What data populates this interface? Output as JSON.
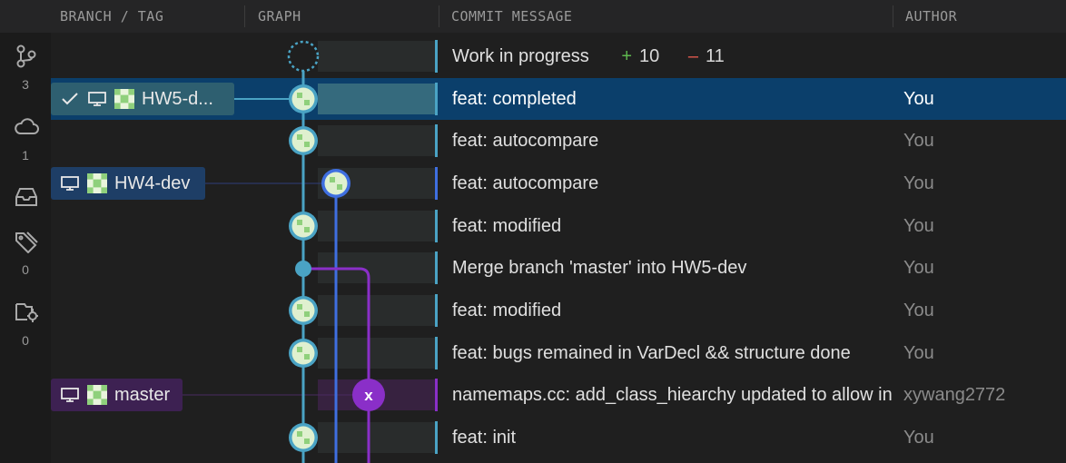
{
  "header": {
    "branch_tag": "BRANCH / TAG",
    "graph": "GRAPH",
    "commit_message": "COMMIT MESSAGE",
    "author": "AUTHOR"
  },
  "rail": {
    "branches_count": "3",
    "remotes_count": "1",
    "tags_count": "0",
    "worktrees_count": "0"
  },
  "wip": {
    "label": "Work in progress",
    "plus": "+",
    "added": "10",
    "minus": "–",
    "removed": "11"
  },
  "commits": [
    {
      "message": "feat: completed",
      "author": "You"
    },
    {
      "message": "feat: autocompare",
      "author": "You"
    },
    {
      "message": "feat: autocompare",
      "author": "You"
    },
    {
      "message": "feat: modified",
      "author": "You"
    },
    {
      "message": "Merge branch 'master' into HW5-dev",
      "author": "You"
    },
    {
      "message": "feat: modified",
      "author": "You"
    },
    {
      "message": "feat: bugs remained in VarDecl && structure done",
      "author": "You"
    },
    {
      "message": "namemaps.cc: add_class_hiearchy updated to allow inheritance",
      "author": "xywang2772"
    },
    {
      "message": "feat: init",
      "author": "You"
    }
  ],
  "branches": {
    "hw5": "HW5-d...",
    "hw4": "HW4-dev",
    "master": "master",
    "master_avatar_letter": "x"
  },
  "colors": {
    "lane_main": "#4aa3c4",
    "lane_hw4": "#3f6fe0",
    "lane_master": "#8a2fc8",
    "selection": "#0b3f6b"
  }
}
